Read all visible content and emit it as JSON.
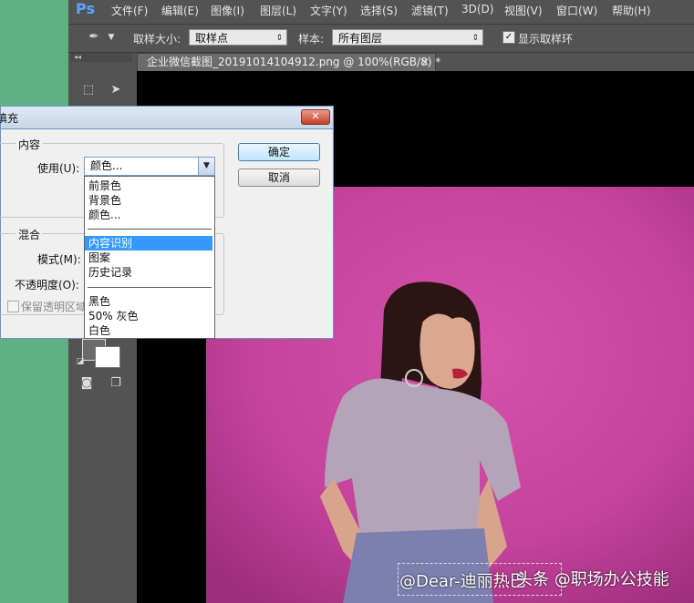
{
  "app": {
    "logo": "Ps"
  },
  "menu": [
    "文件(F)",
    "编辑(E)",
    "图像(I)",
    "图层(L)",
    "文字(Y)",
    "选择(S)",
    "滤镜(T)",
    "3D(D)",
    "视图(V)",
    "窗口(W)",
    "帮助(H)"
  ],
  "options": {
    "sample_size_label": "取样大小:",
    "sample_size_value": "取样点",
    "sample_label": "样本:",
    "sample_value": "所有图层",
    "show_ring_label": "显示取样环",
    "show_ring_checked": true
  },
  "document": {
    "tab_title": "企业微信截图_20191014104912.png @ 100%(RGB/8) *",
    "close": "×"
  },
  "dialog": {
    "title": "填充",
    "close": "✕",
    "content_group": "内容",
    "use_label": "使用(U):",
    "use_value": "颜色...",
    "blend_group": "混合",
    "mode_label": "模式(M):",
    "opacity_label": "不透明度(O):",
    "preserve_label": "保留透明区域",
    "ok": "确定",
    "cancel": "取消"
  },
  "dropdown": {
    "items": [
      "前景色",
      "背景色",
      "颜色...",
      "内容识别",
      "图案",
      "历史记录",
      "黑色",
      "50% 灰色",
      "白色"
    ],
    "selected_index": 3
  },
  "watermark": {
    "weibo": "@Dear-迪丽热巴",
    "toutiao": "头条 @职场办公技能"
  },
  "colors": {
    "ps_bg": "#535353",
    "canvas": "#000000",
    "photo_bg": "#c8459e",
    "side_green": "#5fb184",
    "selection": "#3399ff"
  }
}
